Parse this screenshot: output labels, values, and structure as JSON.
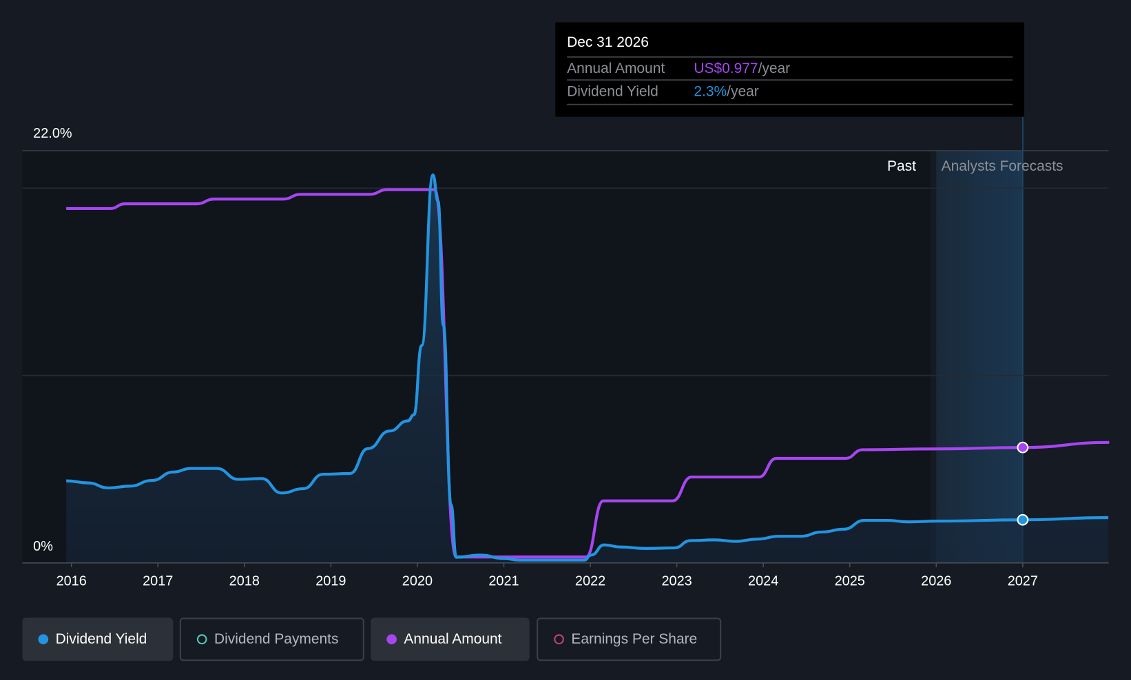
{
  "tooltip": {
    "date": "Dec 31 2026",
    "rows": [
      {
        "label": "Annual Amount",
        "value": "US$0.977",
        "unit": "/year",
        "color": "#a646f0"
      },
      {
        "label": "Dividend Yield",
        "value": "2.3%",
        "unit": "/year",
        "color": "#2394e0"
      }
    ]
  },
  "regions": {
    "past_label": "Past",
    "forecast_label": "Analysts Forecasts"
  },
  "legend": [
    {
      "label": "Dividend Yield",
      "color": "#2394e0",
      "active": true
    },
    {
      "label": "Dividend Payments",
      "color": "#4fc9b8",
      "active": false
    },
    {
      "label": "Annual Amount",
      "color": "#a646f0",
      "active": true
    },
    {
      "label": "Earnings Per Share",
      "color": "#c0407a",
      "active": false
    }
  ],
  "chart_data": {
    "type": "line",
    "y_tick_labels": [
      "22.0%",
      "0%"
    ],
    "ylim": [
      0,
      22
    ],
    "x_tick_labels": [
      "2016",
      "2017",
      "2018",
      "2019",
      "2020",
      "2021",
      "2022",
      "2023",
      "2024",
      "2025",
      "2026",
      "2027"
    ],
    "xlim": [
      2015.94,
      2028.0
    ],
    "forecast_start": 2026.0,
    "highlight": 2027.0,
    "series": [
      {
        "name": "Dividend Yield",
        "unit": "%",
        "color": "#2394e0",
        "x": [
          2015.94,
          2016.19,
          2016.43,
          2016.68,
          2016.93,
          2017.18,
          2017.38,
          2017.68,
          2017.93,
          2018.2,
          2018.43,
          2018.68,
          2018.91,
          2019.22,
          2019.43,
          2019.68,
          2019.89,
          2019.96,
          2020.05,
          2020.18,
          2020.24,
          2020.3,
          2020.39,
          2020.45,
          2020.72,
          2021.01,
          2021.18,
          2021.93,
          2022.01,
          2022.16,
          2022.35,
          2022.64,
          2022.97,
          2023.16,
          2023.43,
          2023.68,
          2023.93,
          2024.18,
          2024.43,
          2024.68,
          2024.93,
          2025.17,
          2025.43,
          2025.68,
          2026.02,
          2027.0,
          2027.99
        ],
        "y": [
          4.38,
          4.27,
          4.0,
          4.1,
          4.4,
          4.85,
          5.04,
          5.04,
          4.46,
          4.5,
          3.73,
          3.96,
          4.73,
          4.77,
          6.1,
          7.04,
          7.58,
          7.9,
          11.6,
          20.7,
          19.3,
          12.7,
          3.1,
          0.3,
          0.42,
          0.23,
          0.15,
          0.15,
          0.42,
          0.96,
          0.85,
          0.77,
          0.8,
          1.19,
          1.23,
          1.15,
          1.27,
          1.42,
          1.42,
          1.65,
          1.8,
          2.27,
          2.27,
          2.19,
          2.23,
          2.3,
          2.42
        ]
      },
      {
        "name": "Annual Amount",
        "unit": "US$",
        "color": "#a646f0",
        "ylim": [
          0,
          3.49
        ],
        "x": [
          2015.94,
          2016.45,
          2016.62,
          2017.45,
          2017.65,
          2018.45,
          2018.65,
          2019.45,
          2019.65,
          2020.2,
          2020.45,
          2021.95,
          2022.15,
          2022.95,
          2023.17,
          2023.95,
          2024.15,
          2024.95,
          2025.15,
          2026.0,
          2027.0,
          2028.0
        ],
        "y": [
          3.0,
          3.0,
          3.04,
          3.04,
          3.08,
          3.08,
          3.12,
          3.12,
          3.16,
          3.16,
          0.05,
          0.05,
          0.525,
          0.525,
          0.727,
          0.727,
          0.885,
          0.885,
          0.958,
          0.965,
          0.977,
          1.02
        ]
      }
    ]
  }
}
